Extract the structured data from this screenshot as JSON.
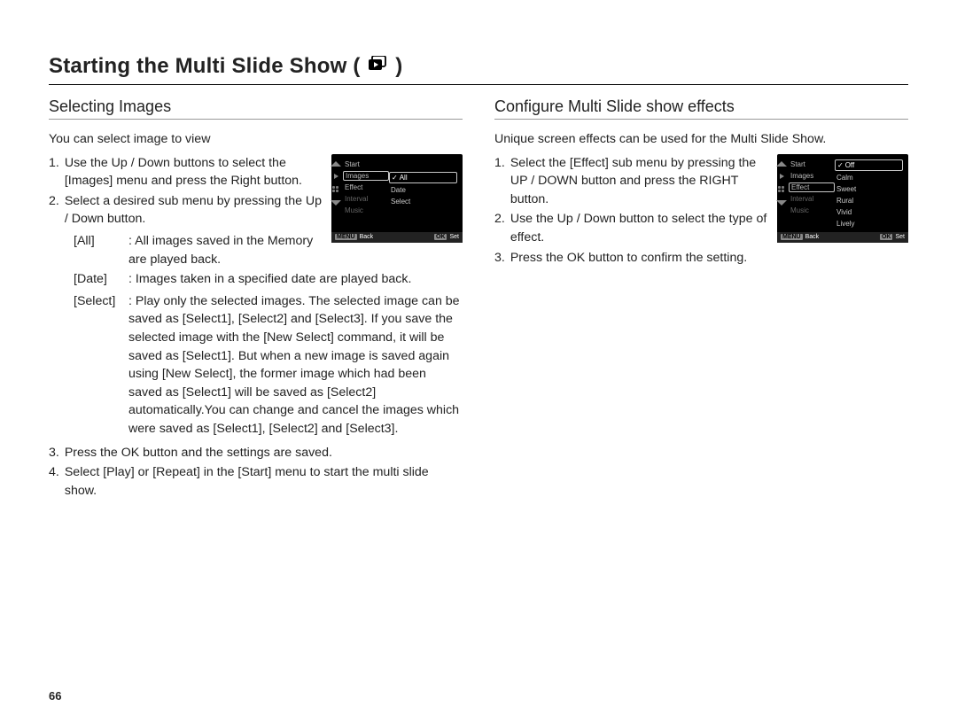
{
  "page_number": "66",
  "title": {
    "text": "Starting the Multi Slide Show",
    "paren_open": " ( ",
    "paren_close": " )"
  },
  "left": {
    "heading": "Selecting Images",
    "intro": "You can select image to view",
    "steps": {
      "s1_num": "1.",
      "s1": "Use the Up / Down buttons to select the [Images] menu and press the Right button.",
      "s2_num": "2.",
      "s2": "Select a desired sub menu by pressing the Up / Down button.",
      "s3_num": "3.",
      "s3": "Press the OK button and the settings are saved.",
      "s4_num": "4.",
      "s4": "Select [Play] or [Repeat] in the [Start] menu to start the multi slide show."
    },
    "defs": {
      "all_term": "[All]",
      "all_desc": ": All images saved in the Memory are played back.",
      "date_term": "[Date]",
      "date_desc": ": Images taken in a specified date are played back.",
      "select_term": "[Select]",
      "select_desc": ": Play only the selected images. The selected image can be saved as [Select1], [Select2] and [Select3]. If you save the selected image with the [New Select] command, it will be saved as [Select1]. But when a new image is saved again using [New Select], the former image which had been saved as [Select1] will be saved as [Select2] automatically.You can change and cancel the images which were saved as [Select1], [Select2] and [Select3]."
    },
    "screenshot": {
      "menu": [
        "Start",
        "Images",
        "Effect",
        "Interval",
        "Music"
      ],
      "highlight_index": 1,
      "dim_indices": [
        3,
        4
      ],
      "options": [
        "All",
        "Date",
        "Select"
      ],
      "selected_option_index": 0,
      "footer_left_tag": "MENU",
      "footer_left_text": "Back",
      "footer_right_tag": "OK",
      "footer_right_text": "Set"
    }
  },
  "right": {
    "heading": "Configure Multi Slide show effects",
    "intro": "Unique screen effects can be used for the Multi Slide Show.",
    "steps": {
      "s1_num": "1.",
      "s1": "Select the [Effect] sub menu by pressing the UP / DOWN button and press the RIGHT button.",
      "s2_num": "2.",
      "s2": "Use the Up / Down button to select the type of effect.",
      "s3_num": "3.",
      "s3": "Press the OK button to confirm the setting."
    },
    "screenshot": {
      "menu": [
        "Start",
        "Images",
        "Effect",
        "Interval",
        "Music"
      ],
      "highlight_index": 2,
      "dim_indices": [
        3,
        4
      ],
      "options": [
        "Off",
        "Calm",
        "Sweet",
        "Rural",
        "Vivid",
        "Lively"
      ],
      "selected_option_index": 0,
      "footer_left_tag": "MENU",
      "footer_left_text": "Back",
      "footer_right_tag": "OK",
      "footer_right_text": "Set"
    }
  }
}
